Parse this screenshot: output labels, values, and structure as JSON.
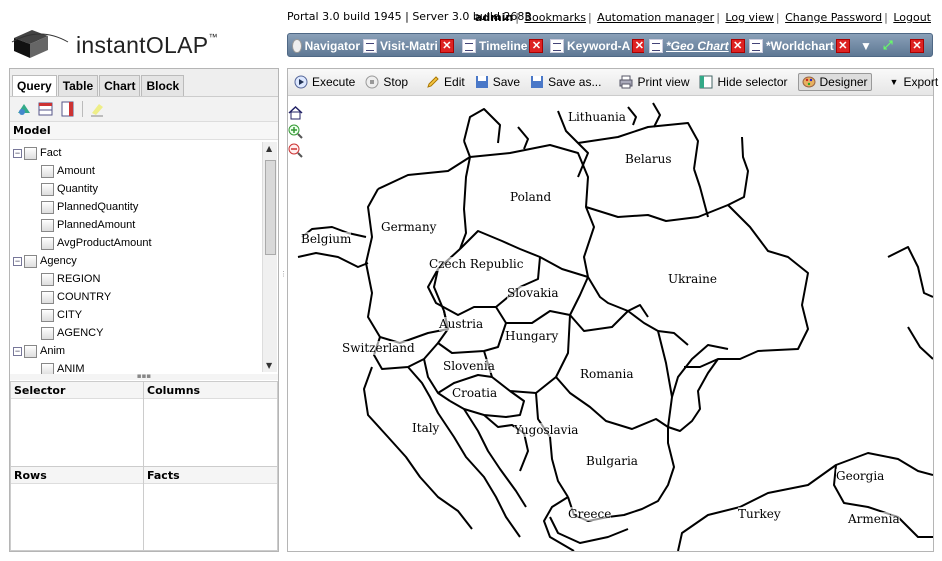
{
  "app": {
    "logo_text": "instantOLAP",
    "logo_tm": "™"
  },
  "header": {
    "build_info": "Portal 3.0 build 1945 | Server 3.0 build 2683",
    "user": "admin",
    "links": [
      "Bookmarks",
      "Automation manager",
      "Log view",
      "Change Password",
      "Logout"
    ]
  },
  "tabs": [
    {
      "label": "Navigator",
      "closable": false,
      "active": false
    },
    {
      "label": "Visit-Matri",
      "closable": true,
      "active": false
    },
    {
      "label": "Timeline",
      "closable": true,
      "active": false
    },
    {
      "label": "Keyword-A",
      "closable": true,
      "active": false
    },
    {
      "label": "*Geo Chart",
      "closable": true,
      "active": true
    },
    {
      "label": "*Worldchart",
      "closable": true,
      "active": false
    }
  ],
  "left_tabs": [
    "Query",
    "Table",
    "Chart",
    "Block"
  ],
  "model": {
    "title": "Model",
    "tree": [
      {
        "label": "Fact",
        "level": 0,
        "expandable": true
      },
      {
        "label": "Amount",
        "level": 1
      },
      {
        "label": "Quantity",
        "level": 1
      },
      {
        "label": "PlannedQuantity",
        "level": 1
      },
      {
        "label": "PlannedAmount",
        "level": 1
      },
      {
        "label": "AvgProductAmount",
        "level": 1
      },
      {
        "label": "Agency",
        "level": 0,
        "expandable": true
      },
      {
        "label": "REGION",
        "level": 1
      },
      {
        "label": "COUNTRY",
        "level": 1
      },
      {
        "label": "CITY",
        "level": 1
      },
      {
        "label": "AGENCY",
        "level": 1
      },
      {
        "label": "Anim",
        "level": 0,
        "expandable": true
      },
      {
        "label": "ANIM",
        "level": 1
      }
    ]
  },
  "zones": {
    "selector": "Selector",
    "columns": "Columns",
    "rows": "Rows",
    "facts": "Facts"
  },
  "toolbar": {
    "execute": "Execute",
    "stop": "Stop",
    "edit": "Edit",
    "save": "Save",
    "save_as": "Save as...",
    "print": "Print view",
    "hide_selector": "Hide selector",
    "designer": "Designer",
    "export": "Export"
  },
  "map": {
    "countries": [
      "Lithuania",
      "Belarus",
      "Poland",
      "Germany",
      "Belgium",
      "Czech Republic",
      "Slovakia",
      "Ukraine",
      "Austria",
      "Hungary",
      "Switzerland",
      "Slovenia",
      "Romania",
      "Croatia",
      "Italy",
      "Yugoslavia",
      "Bulgaria",
      "Georgia",
      "Greece",
      "Turkey",
      "Armenia"
    ]
  },
  "colors": {
    "tab_bar": "#6b84a0",
    "close": "#dd2222"
  }
}
